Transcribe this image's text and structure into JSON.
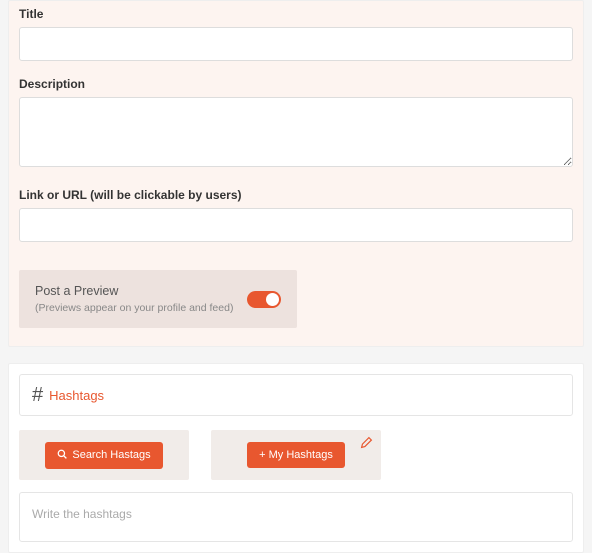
{
  "form": {
    "title_label": "Title",
    "title_value": "",
    "description_label": "Description",
    "description_value": "",
    "link_label": "Link or URL (will be clickable by users)",
    "link_value": ""
  },
  "preview": {
    "title": "Post a Preview",
    "subtitle": "(Previews appear on your profile and feed)",
    "toggle_on": true
  },
  "hashtags": {
    "section_title": "Hashtags",
    "search_button": "Search Hastags",
    "my_button": "+ My Hashtags",
    "input_placeholder": "Write the hashtags",
    "input_value": ""
  },
  "colors": {
    "accent": "#e8572f",
    "panel_bg": "#fdf4f0",
    "sub_panel": "#ede2de"
  }
}
